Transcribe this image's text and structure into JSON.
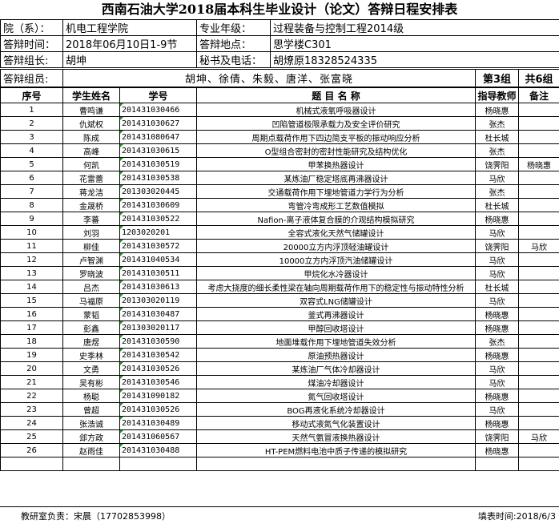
{
  "title": "西南石油大学2018届本科生毕业设计（论文）答辩日程安排表",
  "info": {
    "dept_label": "院（系）：",
    "dept_value": "机电工程学院",
    "major_label": "专业年级：",
    "major_value": "过程装备与控制工程2014级",
    "time_label": "答辩时间：",
    "time_value": "2018年06月10日1-9节",
    "place_label": "答辩地点：",
    "place_value": "思学楼C301",
    "leader_label": "答辩组长:",
    "leader_value": "胡坤",
    "secretary_label": "秘书及电话：",
    "secretary_value": "胡燎原18328524335"
  },
  "members": {
    "label": "答辩组员:",
    "value": "胡坤、徐倩、朱毅、唐洋、张富晓",
    "group": "第3组",
    "total": "共6组"
  },
  "table": {
    "headers": [
      "序号",
      "学生姓名",
      "学号",
      "题 目 名 称",
      "指导教师",
      "备注"
    ],
    "rows": [
      [
        "1",
        "曹鸣谦",
        "201431030466",
        "机械式液氧呼吸器设计",
        "杨晓惠",
        ""
      ],
      [
        "2",
        "仇斌权",
        "201431030627",
        "凹陷管道极限承载力及安全评价研究",
        "张杰",
        ""
      ],
      [
        "3",
        "陈成",
        "201431080647",
        "周期点载荷作用下四边简支平板的振动响应分析",
        "杜长城",
        ""
      ],
      [
        "4",
        "高峰",
        "201431030615",
        "O型组合密封的密封性能研究及结构优化",
        "张杰",
        ""
      ],
      [
        "5",
        "何凯",
        "201431030519",
        "甲苯换热器设计",
        "饶霁阳",
        "杨晓惠"
      ],
      [
        "6",
        "花雷蕾",
        "201431030538",
        "某炼油厂稳定塔底再沸器设计",
        "马欣",
        ""
      ],
      [
        "7",
        "蒋龙洁",
        "201303020445",
        "交通载荷作用下埋地管道力学行为分析",
        "张杰",
        ""
      ],
      [
        "8",
        "金晟桥",
        "201431030609",
        "弯管冷弯成形工艺数值模拟",
        "杜长城",
        ""
      ],
      [
        "9",
        "李蕃",
        "201431030522",
        "Nafion-离子液体复合膜的介观结构模拟研究",
        "杨晓惠",
        ""
      ],
      [
        "10",
        "刘羽",
        "1203020201",
        "全容式液化天然气储罐设计",
        "马欣",
        ""
      ],
      [
        "11",
        "柳佳",
        "201431030572",
        "20000立方内浮顶轻油罐设计",
        "饶霁阳",
        "马欣"
      ],
      [
        "12",
        "卢智渊",
        "201431040534",
        "10000立方内浮顶汽油储罐设计",
        "马欣",
        ""
      ],
      [
        "13",
        "罗晓波",
        "201431030511",
        "甲烷化水冷器设计",
        "马欣",
        ""
      ],
      [
        "14",
        "吕杰",
        "201431030613",
        "考虑大挠度的细长柔性梁在轴向周期载荷作用下的稳定性与振动特性分析",
        "杜长城",
        ""
      ],
      [
        "15",
        "马福原",
        "201303020119",
        "双容式LNG储罐设计",
        "马欣",
        ""
      ],
      [
        "16",
        "蒙韬",
        "201431030487",
        "釜式再沸器设计",
        "杨晓惠",
        ""
      ],
      [
        "17",
        "彭鑫",
        "201303020117",
        "甲醇回收塔设计",
        "杨晓惠",
        ""
      ],
      [
        "18",
        "唐煜",
        "201431030590",
        "地面堆载作用下埋地管道失效分析",
        "张杰",
        ""
      ],
      [
        "19",
        "史季林",
        "201431030542",
        "原油预热器设计",
        "杨晓惠",
        ""
      ],
      [
        "20",
        "文勇",
        "201431030526",
        "某炼油厂气体冷却器设计",
        "马欣",
        ""
      ],
      [
        "21",
        "吴有彬",
        "201431030546",
        "煤油冷却器设计",
        "马欣",
        ""
      ],
      [
        "22",
        "杨聪",
        "201431090182",
        "氮气回收塔设计",
        "杨晓惠",
        ""
      ],
      [
        "23",
        "曾超",
        "201431030526",
        "BOG再液化系统冷却器设计",
        "马欣",
        ""
      ],
      [
        "24",
        "张浩诚",
        "201431030489",
        "移动式液氮气化装置设计",
        "杨晓惠",
        ""
      ],
      [
        "25",
        "郐方政",
        "201431060567",
        "天然气氨冒液换热器设计",
        "饶霁阳",
        "马欣"
      ],
      [
        "26",
        "赵雨佳",
        "201431030488",
        "HT-PEM燃料电池中质子传递的模拟研究",
        "杨晓惠",
        ""
      ]
    ]
  },
  "footer": {
    "left": "教研室负责：宋晨（17702853998）",
    "right": "填表时间:2018/6/3"
  }
}
